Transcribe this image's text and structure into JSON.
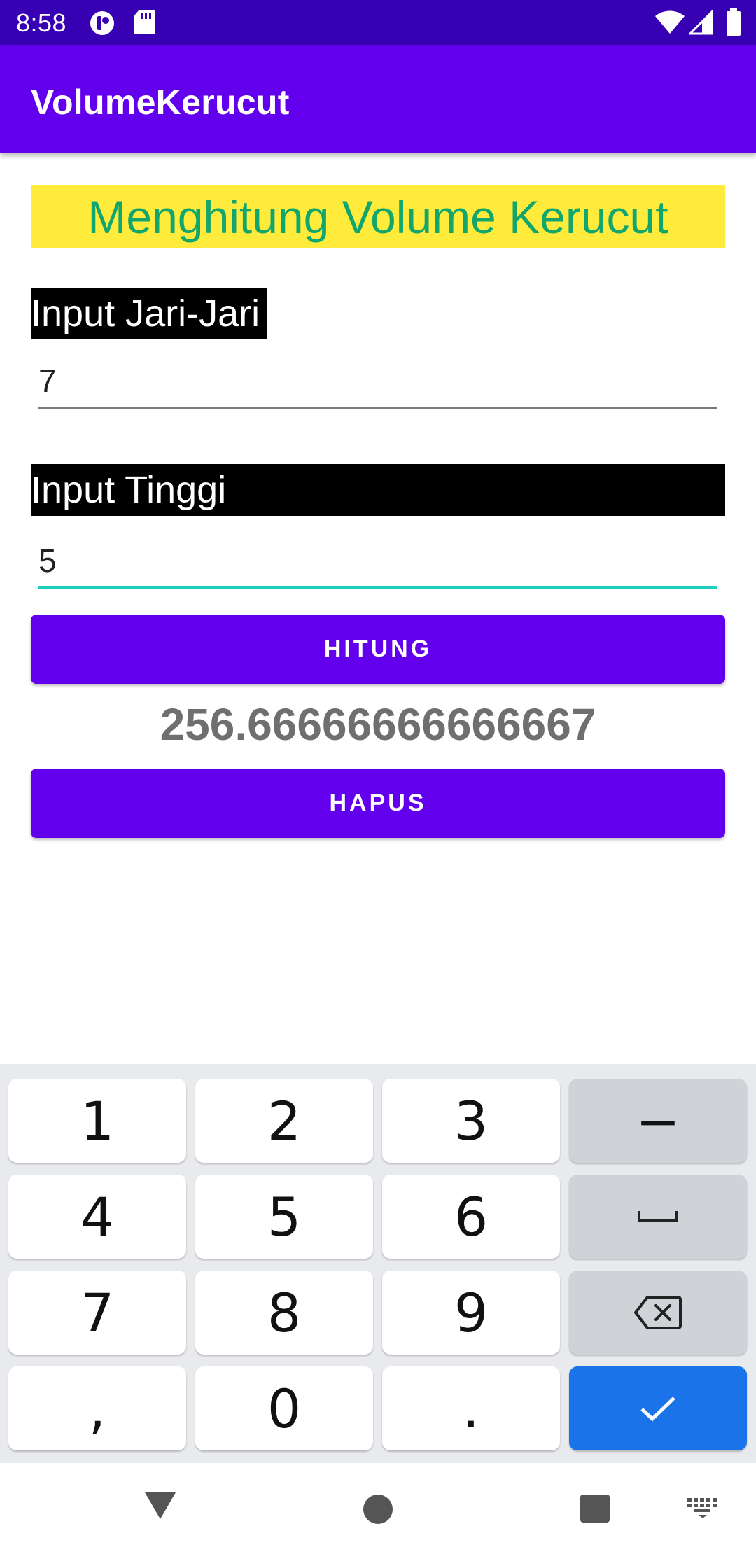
{
  "status_bar": {
    "time": "8:58",
    "icons": [
      "app-notification-icon",
      "sd-card-icon",
      "wifi-icon",
      "cell-signal-icon",
      "battery-icon"
    ]
  },
  "app_bar": {
    "title": "VolumeKerucut"
  },
  "main": {
    "heading": "Menghitung Volume Kerucut",
    "radius_label": "Input Jari-Jari",
    "radius_value": "7",
    "height_label": "Input Tinggi",
    "height_value": "5",
    "calculate_button": "HITUNG",
    "result": "256.66666666666667",
    "clear_button": "HAPUS"
  },
  "keyboard": {
    "keys": [
      [
        "1",
        "2",
        "3",
        "−"
      ],
      [
        "4",
        "5",
        "6",
        "space"
      ],
      [
        "7",
        "8",
        "9",
        "backspace"
      ],
      [
        ",",
        "0",
        ".",
        "done"
      ]
    ],
    "labels": {
      "k1": "1",
      "k2": "2",
      "k3": "3",
      "minus": "−",
      "k4": "4",
      "k5": "5",
      "k6": "6",
      "k7": "7",
      "k8": "8",
      "k9": "9",
      "comma": ",",
      "k0": "0",
      "period": "."
    }
  },
  "colors": {
    "status_bar": "#3700b3",
    "primary": "#6200ee",
    "heading_bg": "#ffeb3b",
    "heading_text": "#12a66c",
    "field_focus": "#1ecfc0",
    "result_text": "#6f6f6f",
    "keyboard_bg": "#e8eaed",
    "enter_key": "#1a73e8"
  },
  "nav_bar": {
    "icons": [
      "back-icon",
      "home-icon",
      "recents-icon",
      "keyboard-switch-icon"
    ]
  }
}
